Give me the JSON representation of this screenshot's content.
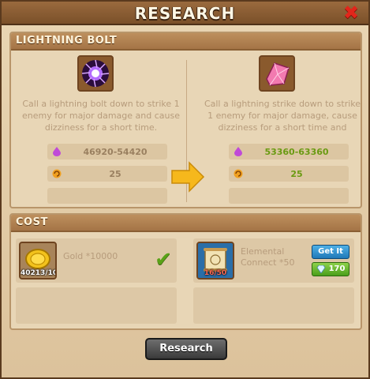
{
  "title": "RESEARCH",
  "spell_panel": {
    "header": "LIGHTNING BOLT",
    "current": {
      "description": "Call a lightning bolt down to strike 1 enemy for major damage and cause dizziness for a short time.",
      "damage": "46920-54420",
      "duration": "25"
    },
    "next": {
      "description": "Call a lightning strike down to strike 1 enemy for major damage, cause dizziness for a short time and",
      "damage": "53360-63360",
      "duration": "25"
    }
  },
  "cost_panel": {
    "header": "COST",
    "gold": {
      "count": "40213/10000",
      "name": "Gold *10000"
    },
    "scroll": {
      "count": "16/50",
      "name": "Elemental Connect *50",
      "get_label": "Get It",
      "gem_cost": "170"
    }
  },
  "research_button": "Research",
  "colors": {
    "accent_green": "#5aa218",
    "close_red": "#e2261b",
    "new_value_green": "#6a9a12"
  }
}
